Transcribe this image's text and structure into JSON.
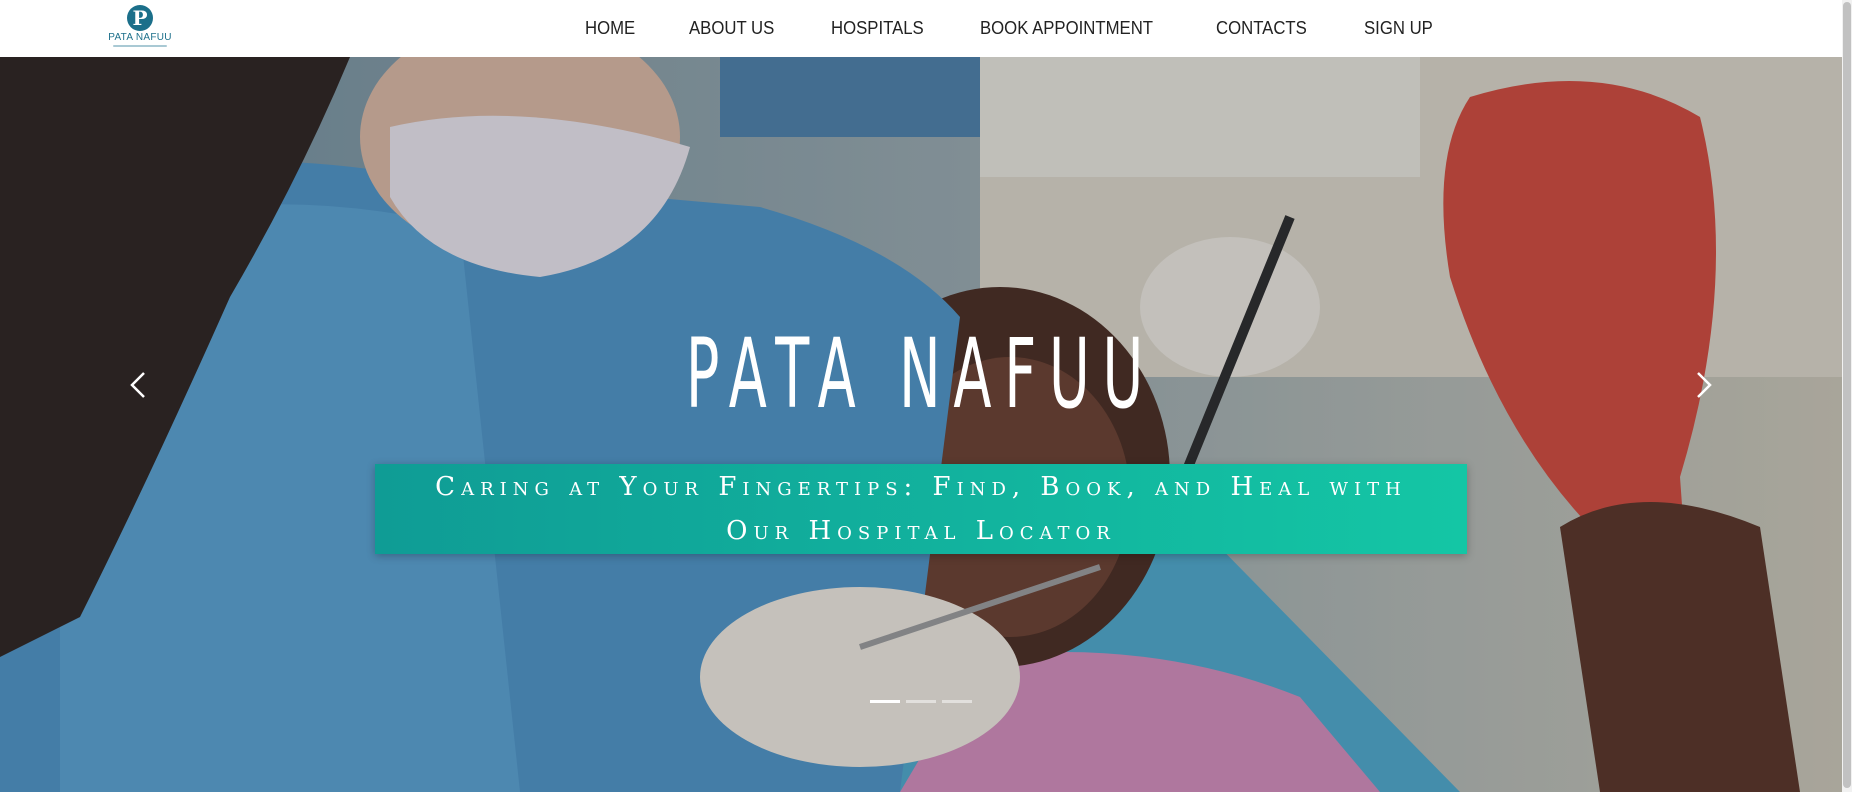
{
  "header": {
    "logo_text": "PATA NAFUU",
    "logo_icon": "letter-p-pin-icon",
    "nav": [
      {
        "label": "HOME"
      },
      {
        "label": "ABOUT US"
      },
      {
        "label": "HOSPITALS"
      },
      {
        "label": "BOOK APPOINTMENT"
      },
      {
        "label": "CONTACTS"
      },
      {
        "label": "SIGN UP"
      }
    ]
  },
  "hero": {
    "title": "PATA NAFUU",
    "subtitle": "Caring at Your Fingertips: Find, Book, and Heal with Our Hospital Locator",
    "prev_icon": "chevron-left-icon",
    "next_icon": "chevron-right-icon",
    "slides_count": 3,
    "active_slide": 1
  },
  "colors": {
    "brand": "#1b6f8a",
    "banner_start": "#0f9c95",
    "banner_end": "#14c6a5",
    "nav_text": "#222222"
  }
}
